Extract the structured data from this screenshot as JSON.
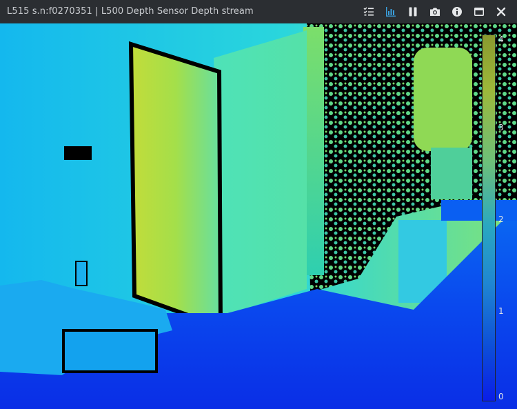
{
  "window": {
    "title": "L515 s.n:f0270351 | L500 Depth Sensor Depth stream"
  },
  "toolbar": {
    "buttons": [
      {
        "name": "metadata-button",
        "icon": "list-check-icon",
        "active": false
      },
      {
        "name": "histogram-button",
        "icon": "bar-chart-icon",
        "active": true
      },
      {
        "name": "pause-button",
        "icon": "pause-icon",
        "active": false
      },
      {
        "name": "snapshot-button",
        "icon": "camera-icon",
        "active": false
      },
      {
        "name": "info-button",
        "icon": "info-icon",
        "active": false
      },
      {
        "name": "maximize-button",
        "icon": "window-icon",
        "active": false
      },
      {
        "name": "close-button",
        "icon": "close-icon",
        "active": false
      }
    ],
    "active_color": "#3a9fdc",
    "icon_color": "#e6e8ea"
  },
  "colorbar": {
    "ticks": [
      "4",
      "3",
      "2",
      "1",
      "0"
    ],
    "range": [
      0,
      4
    ],
    "colors": [
      "#8a9a2e",
      "#b7d43a",
      "#48d8c8",
      "#1ca8f0",
      "#0b4df2",
      "#0a1ee8"
    ]
  }
}
